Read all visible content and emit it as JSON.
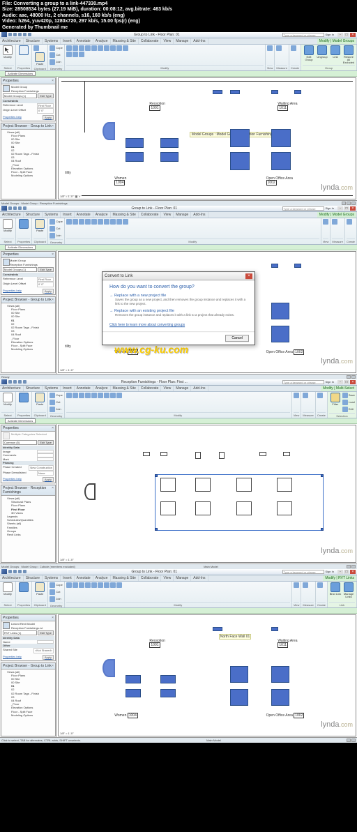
{
  "meta": {
    "file": "File: Converting a group to a link-447330.mp4",
    "size": "Size: 28508534 bytes (27.19 MiB), duration: 00:08:12, avg.bitrate: 463 kb/s",
    "audio": "Audio: aac, 48000 Hz, 2 channels, s16, 160 kb/s (eng)",
    "video": "Video: h264, yuv420p, 1280x720, 297 kb/s, 15.00 fps(r) (eng)",
    "gen": "Generated by Thumbnail me"
  },
  "title1": "Group to Link - Floor Plan: 01",
  "title3": "Reception Furnishings - Floor Plan: First ...",
  "title4": "Group to Link - Floor Plan: 01",
  "searchPlaceholder": "Type a keyword or phrase",
  "signin": "Sign In",
  "tabs": {
    "t0": "Architecture",
    "t1": "Structure",
    "t2": "Systems",
    "t3": "Insert",
    "t4": "Annotate",
    "t5": "Analyze",
    "t6": "Massing & Site",
    "t7": "Collaborate",
    "t8": "View",
    "t9": "Manage",
    "t10": "Add-Ins",
    "t11": "Modify | Model Groups",
    "t12": "Modify | Multi-Select",
    "t13": "Modify | RVT Links"
  },
  "ribbon": {
    "modify": "Modify",
    "select": "Select",
    "properties": "Properties",
    "clipboard": "Clipboard",
    "geometry": "Geometry",
    "modify_grp": "Modify",
    "view": "View",
    "measure": "Measure",
    "create": "Create",
    "group": "Group",
    "selection": "Selection",
    "link": "Link",
    "cope": "Cope",
    "cut": "Cut",
    "join": "Join",
    "paste": "Paste",
    "editGroup": "Edit Group",
    "ungroup": "Ungroup",
    "linkBtn": "Link",
    "restore": "Restore All Excluded",
    "filter": "Filter",
    "save": "Save",
    "load": "Load",
    "edit": "Edit",
    "bind": "Bind Link",
    "manage": "Manage Links"
  },
  "greenStrip": {
    "activate": "Activate Dimensions"
  },
  "props": {
    "header": "Properties",
    "modelGroup": "Model Group",
    "reception": "Reception Furnishings",
    "mg1": "Model Groups (1)",
    "editType": "Edit Type",
    "common": "Common (5)",
    "multiCat": "Multiple Categories Selected",
    "linkedModel": "Linked Revit Model",
    "receptionRvt": "Reception Furnishings.rvt",
    "rvtLinks": "RVT Links (1)",
    "cat_constraints": "Constraints",
    "refLevel": "Reference Level",
    "refLevelVal": "First Floor",
    "origOffset": "Origin Level Offset",
    "origOffsetVal": "0' 0\"",
    "cat_identity": "Identity Data",
    "image": "Image",
    "comments": "Comments",
    "mark": "Mark",
    "cat_phasing": "Phasing",
    "phaseCreated": "Phase Created",
    "phaseCreatedVal": "New Construction",
    "phaseDemo": "Phase Demolished",
    "phaseDemoVal": "None",
    "name": "Name",
    "cat_other": "Other",
    "sharedSite": "Shared Site",
    "sharedSiteVal": "<Not Shared>",
    "help": "Properties help",
    "apply": "Apply"
  },
  "browser": {
    "hdr1": "Project Browser - Group to Link",
    "hdr2": "Project Browser - Reception Furnishings",
    "views": "Views (all)",
    "floorPlans": "Floor Plans",
    "structural": "Structural Plans",
    "i00": "00 Site",
    "i01": "01",
    "i02": "02",
    "i02r": "02 Room Tags - Finish",
    "i03": "03",
    "i04": "04 Roof",
    "iFloor": "_Floor",
    "iElev": "Elevation Options",
    "iSplit": "Floor - Split Face",
    "iModel": "Modeling Options",
    "firstFloor": "First Floor",
    "threeD": "3D Views",
    "legends": "Legends",
    "sched": "Schedules/Quantities",
    "sheets": "Sheets (all)",
    "families": "Families",
    "groups": "Groups",
    "revitLinks": "Revit Links"
  },
  "canvas": {
    "reception": "Reception",
    "receptionNum": "1001",
    "waiting": "Waiting Area",
    "waitingNum": "1011",
    "women": "Women",
    "womenNum": "1004",
    "openOffice": "Open Office Area",
    "openOfficeNum": "1002",
    "tility": "tility",
    "scale": "1/8\" = 1'-0\"",
    "tooltip": "Model Groups : Model Group : Reception Furnishings",
    "tooltip4": "North Face Wall 01"
  },
  "dialog": {
    "title": "Convert to Link",
    "q": "How do you want to convert the group?",
    "o1t": "Replace with a new project file",
    "o1d": "Saves the group as a new project, and then removes the group instance and replaces it with a link to the new project.",
    "o2t": "Replace with an existing project file",
    "o2d": "Removes the group instance and replaces it with a link to a project that already exists.",
    "link": "Click here to learn more about converting groups",
    "cancel": "Cancel"
  },
  "status": {
    "s1": "Model Groups : Model Group : Reception Furnishings",
    "s3": "Model Groups : Model Group : Cubicle (members excluded)",
    "s4": "Click to select, TAB for alternates, CTRL adds, SHIFT unselects.",
    "ready": "Ready",
    "mainModel": "Main Model"
  },
  "wm": "www.cg-ku.com",
  "lynda": "lynda",
  "lyndaCom": ".com"
}
